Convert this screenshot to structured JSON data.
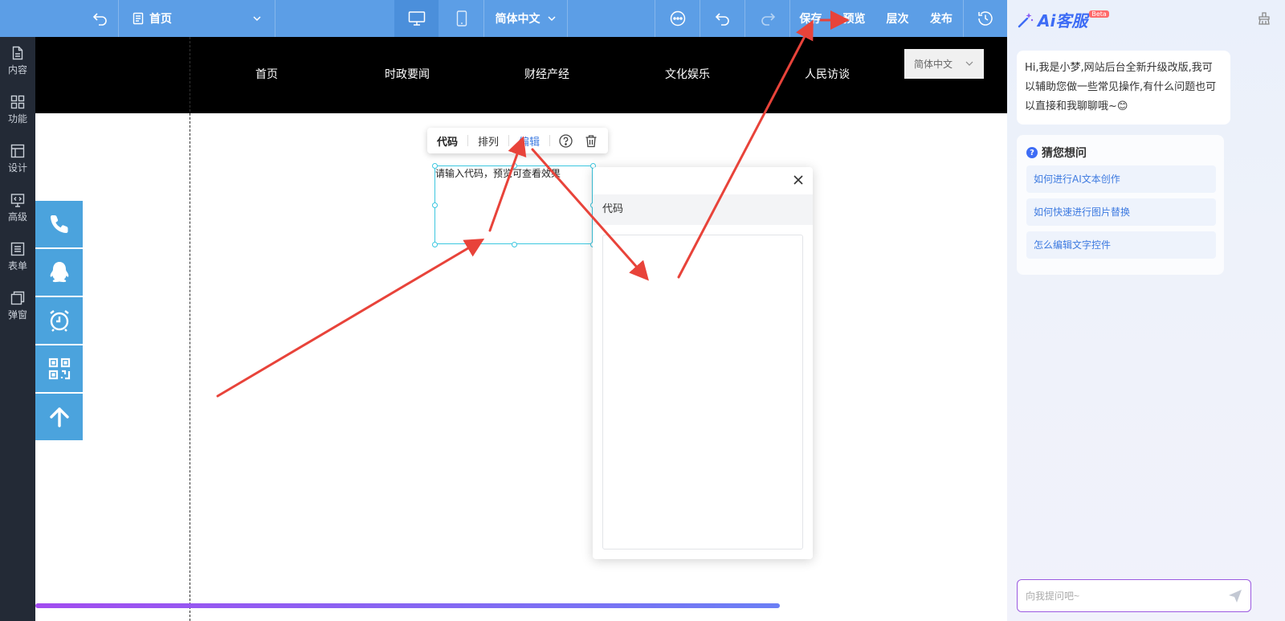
{
  "toolbar": {
    "back_icon": "undo-arrow-icon",
    "page_selector": {
      "label": "首页",
      "icon": "page-icon"
    },
    "device_desktop_icon": "desktop-icon",
    "device_mobile_icon": "mobile-icon",
    "language": "简体中文",
    "more_icon": "more-icon",
    "undo_icon": "undo-icon",
    "redo_icon": "redo-icon",
    "save_label": "保存",
    "preview_label": "预览",
    "layers_label": "层次",
    "publish_label": "发布",
    "history_icon": "history-icon"
  },
  "sidebar": {
    "items": [
      {
        "label": "内容",
        "icon": "document-icon"
      },
      {
        "label": "功能",
        "icon": "grid-icon"
      },
      {
        "label": "设计",
        "icon": "layout-icon"
      },
      {
        "label": "高级",
        "icon": "code-monitor-icon"
      },
      {
        "label": "表单",
        "icon": "form-icon"
      },
      {
        "label": "弹窗",
        "icon": "popup-icon"
      }
    ]
  },
  "site": {
    "nav": [
      "首页",
      "时政要闻",
      "财经产经",
      "文化娱乐",
      "人民访谈"
    ],
    "language_select": "简体中文",
    "float_buttons": [
      "phone-icon",
      "qq-penguin-icon",
      "alarm-clock-icon",
      "qr-code-icon",
      "arrow-up-icon"
    ]
  },
  "element_toolbar": {
    "code_label": "代码",
    "arrange_label": "排列",
    "edit_label": "编辑",
    "help_icon": "help-icon",
    "delete_icon": "trash-icon"
  },
  "code_block": {
    "placeholder": "请输入代码，预览可查看效果"
  },
  "code_panel": {
    "title": "代码",
    "close_icon": "close-icon",
    "value": ""
  },
  "ai_panel": {
    "brand": "Ai客服",
    "beta": "Beta",
    "greeting": "Hi,我是小梦,网站后台全新升级改版,我可以辅助您做一些常见操作,有什么问题也可以直接和我聊聊哦~😊",
    "guess_title": "猜您想问",
    "questions": [
      "如何进行AI文本创作",
      "如何快速进行图片替换",
      "怎么编辑文字控件"
    ],
    "input_placeholder": "向我提问吧~",
    "send_icon": "send-icon",
    "clear_icon": "broom-icon"
  },
  "colors": {
    "toolbar_bg": "#5c9ee6",
    "sidebar_bg": "#232a36",
    "float_bar": "#4ba3dd",
    "selection": "#3cc7e0",
    "accent": "#3d7ae0",
    "arrow": "#e8433a"
  }
}
